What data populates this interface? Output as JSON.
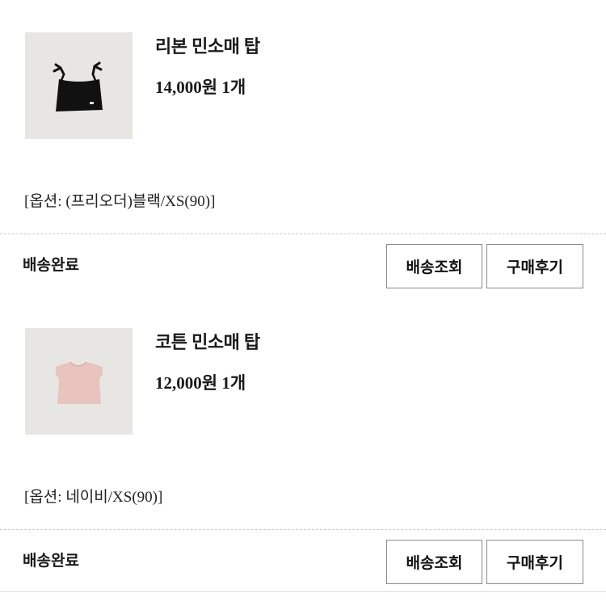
{
  "orders": [
    {
      "name": "리본 민소매 탑",
      "price": "14,000원 1개",
      "option": "[옵션: (프리오더)블랙/XS(90)]",
      "status": "배송완료",
      "track_label": "배송조회",
      "review_label": "구매후기",
      "thumbnail": "black-ribbon-sleeveless-top",
      "thumb_color": "#111111"
    },
    {
      "name": "코튼 민소매 탑",
      "price": "12,000원 1개",
      "option": "[옵션: 네이비/XS(90)]",
      "status": "배송완료",
      "track_label": "배송조회",
      "review_label": "구매후기",
      "thumbnail": "pink-cotton-sleeveless-top",
      "thumb_color": "#e9c3bd"
    }
  ]
}
